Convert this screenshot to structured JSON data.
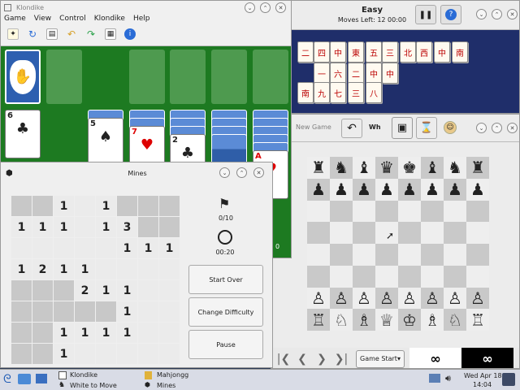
{
  "mahjongg": {
    "title": "Easy",
    "status": "Moves Left: 12   00:00",
    "tiles": [
      "二",
      "四",
      "中",
      "東",
      "五",
      "三",
      "北",
      "西",
      "中",
      "南",
      "一",
      "六",
      "二",
      "中",
      "中",
      "南",
      "九",
      "七",
      "三",
      "八"
    ]
  },
  "klondike": {
    "title": "Klondike",
    "menu": [
      "Game",
      "View",
      "Control",
      "Klondike",
      "Help"
    ],
    "cols": [
      {
        "back": 0,
        "faces": [
          {
            "r": "6",
            "s": "♣",
            "red": false
          }
        ]
      },
      {
        "back": 1,
        "faces": [
          {
            "r": "5",
            "s": "♠",
            "red": false
          }
        ]
      },
      {
        "back": 2,
        "faces": [
          {
            "r": "7",
            "s": "♥",
            "red": true
          }
        ]
      },
      {
        "back": 3,
        "faces": [
          {
            "r": "2",
            "s": "♣",
            "red": false
          }
        ]
      },
      {
        "back": 4,
        "faces": []
      },
      {
        "back": 5,
        "faces": [
          {
            "r": "A",
            "s": "♥",
            "red": true
          }
        ]
      }
    ],
    "partial_num": "0"
  },
  "chess": {
    "title": "White to Move",
    "toolbar_new": "New Game",
    "toolbar_wh": "Wh",
    "history_label": "Game Start",
    "clock_white": "∞",
    "clock_black": "∞",
    "board": [
      [
        "♜",
        "♞",
        "♝",
        "♛",
        "♚",
        "♝",
        "♞",
        "♜"
      ],
      [
        "♟",
        "♟",
        "♟",
        "♟",
        "♟",
        "♟",
        "♟",
        "♟"
      ],
      [
        "",
        "",
        "",
        "",
        "",
        "",
        "",
        ""
      ],
      [
        "",
        "",
        "",
        "",
        "",
        "",
        "",
        ""
      ],
      [
        "",
        "",
        "",
        "",
        "",
        "",
        "",
        ""
      ],
      [
        "",
        "",
        "",
        "",
        "",
        "",
        "",
        ""
      ],
      [
        "♙",
        "♙",
        "♙",
        "♙",
        "♙",
        "♙",
        "♙",
        "♙"
      ],
      [
        "♖",
        "♘",
        "♗",
        "♕",
        "♔",
        "♗",
        "♘",
        "♖"
      ]
    ]
  },
  "mines": {
    "title": "Mines",
    "flags": "0/10",
    "time": "00:20",
    "buttons": {
      "start_over": "Start Over",
      "change_difficulty": "Change Difficulty",
      "pause": "Pause"
    },
    "grid": [
      [
        "c",
        "c",
        "1",
        "o",
        "1",
        "c",
        "c",
        "c"
      ],
      [
        "1",
        "1",
        "1",
        "o",
        "1",
        "3",
        "c",
        "c"
      ],
      [
        "o",
        "o",
        "o",
        "o",
        "o",
        "1",
        "1",
        "1"
      ],
      [
        "1",
        "2",
        "1",
        "1",
        "o",
        "o",
        "o",
        "o"
      ],
      [
        "c",
        "c",
        "c",
        "2",
        "1",
        "1",
        "o",
        "o"
      ],
      [
        "c",
        "c",
        "c",
        "c",
        "c",
        "1",
        "o",
        "o"
      ],
      [
        "c",
        "c",
        "1",
        "1",
        "1",
        "1",
        "o",
        "o"
      ],
      [
        "c",
        "c",
        "1",
        "o",
        "o",
        "o",
        "o",
        "o"
      ]
    ]
  },
  "taskbar": {
    "items": [
      "Klondike",
      "White to Move",
      "Mahjongg",
      "Mines"
    ],
    "clock_date": "Wed Apr 18",
    "clock_time": "14:04"
  },
  "colors": {
    "felt": "#1d7a21",
    "mahjongg_bg": "#1f2e6a",
    "board_border": "#3c3c3c"
  }
}
